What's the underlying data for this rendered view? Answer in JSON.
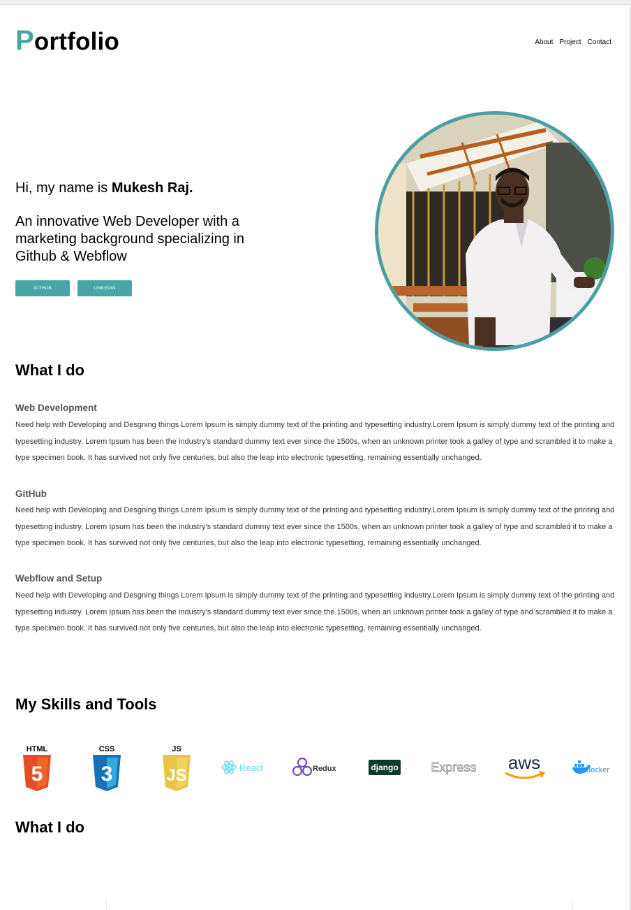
{
  "header": {
    "logo_first": "P",
    "logo_rest": "ortfolio",
    "nav": [
      "About",
      "Project",
      "Contact"
    ]
  },
  "hero": {
    "greeting": "Hi, my name is ",
    "name": "Mukesh Raj.",
    "tagline": "An innovative Web Developer with a marketing background specializing in Github & Webflow",
    "buttons": [
      "GITHUB",
      "LINKEDIN"
    ]
  },
  "what_i_do": {
    "heading": "What I do",
    "services": [
      {
        "title": "Web Development",
        "text": "Need help with Developing and Desgning things Lorem Ipsum is simply dummy text of the printing and typesetting industry.Lorem Ipsum is simply dummy text of the printing and typesetting industry. Lorem Ipsum has been the industry's standard dummy text ever since the 1500s, when an unknown printer took a galley of type and scrambled it to make a type specimen book. It has survived not only five centuries, but also the leap into electronic typesetting, remaining essentially unchanged."
      },
      {
        "title": "GitHub",
        "text": "Need help with Developing and Desgning things Lorem Ipsum is simply dummy text of the printing and typesetting industry.Lorem Ipsum is simply dummy text of the printing and typesetting industry. Lorem Ipsum has been the industry's standard dummy text ever since the 1500s, when an unknown printer took a galley of type and scrambled it to make a type specimen book. It has survived not only five centuries, but also the leap into electronic typesetting, remaining essentially unchanged."
      },
      {
        "title": "Webflow and Setup",
        "text": "Need help with Developing and Desgning things Lorem Ipsum is simply dummy text of the printing and typesetting industry.Lorem Ipsum is simply dummy text of the printing and typesetting industry. Lorem Ipsum has been the industry's standard dummy text ever since the 1500s, when an unknown printer took a galley of type and scrambled it to make a type specimen book. It has survived not only five centuries, but also the leap into electronic typesetting, remaining essentially unchanged."
      }
    ]
  },
  "skills": {
    "heading": "My Skills and Tools",
    "logos": [
      {
        "icon": "html5-icon",
        "label": "HTML",
        "color": "#e44d26"
      },
      {
        "icon": "css3-icon",
        "label": "CSS",
        "color": "#2965f1"
      },
      {
        "icon": "js-icon",
        "label": "JS",
        "color": "#e8c547"
      },
      {
        "icon": "react-icon",
        "label": "React",
        "color": "#61dafb"
      },
      {
        "icon": "redux-icon",
        "label": "Redux",
        "color": "#764abc"
      },
      {
        "icon": "django-icon",
        "label": "django",
        "color": "#0c4b33"
      },
      {
        "icon": "express-icon",
        "label": "Express",
        "color": "#888888"
      },
      {
        "icon": "aws-icon",
        "label": "aws",
        "color": "#ff9900"
      },
      {
        "icon": "docker-icon",
        "label": "docker",
        "color": "#2496ed"
      }
    ]
  },
  "what_i_do_2": {
    "heading": "What I do"
  },
  "colors": {
    "accent": "#49a6a6",
    "avatar_ring": "#4a9fa3"
  }
}
